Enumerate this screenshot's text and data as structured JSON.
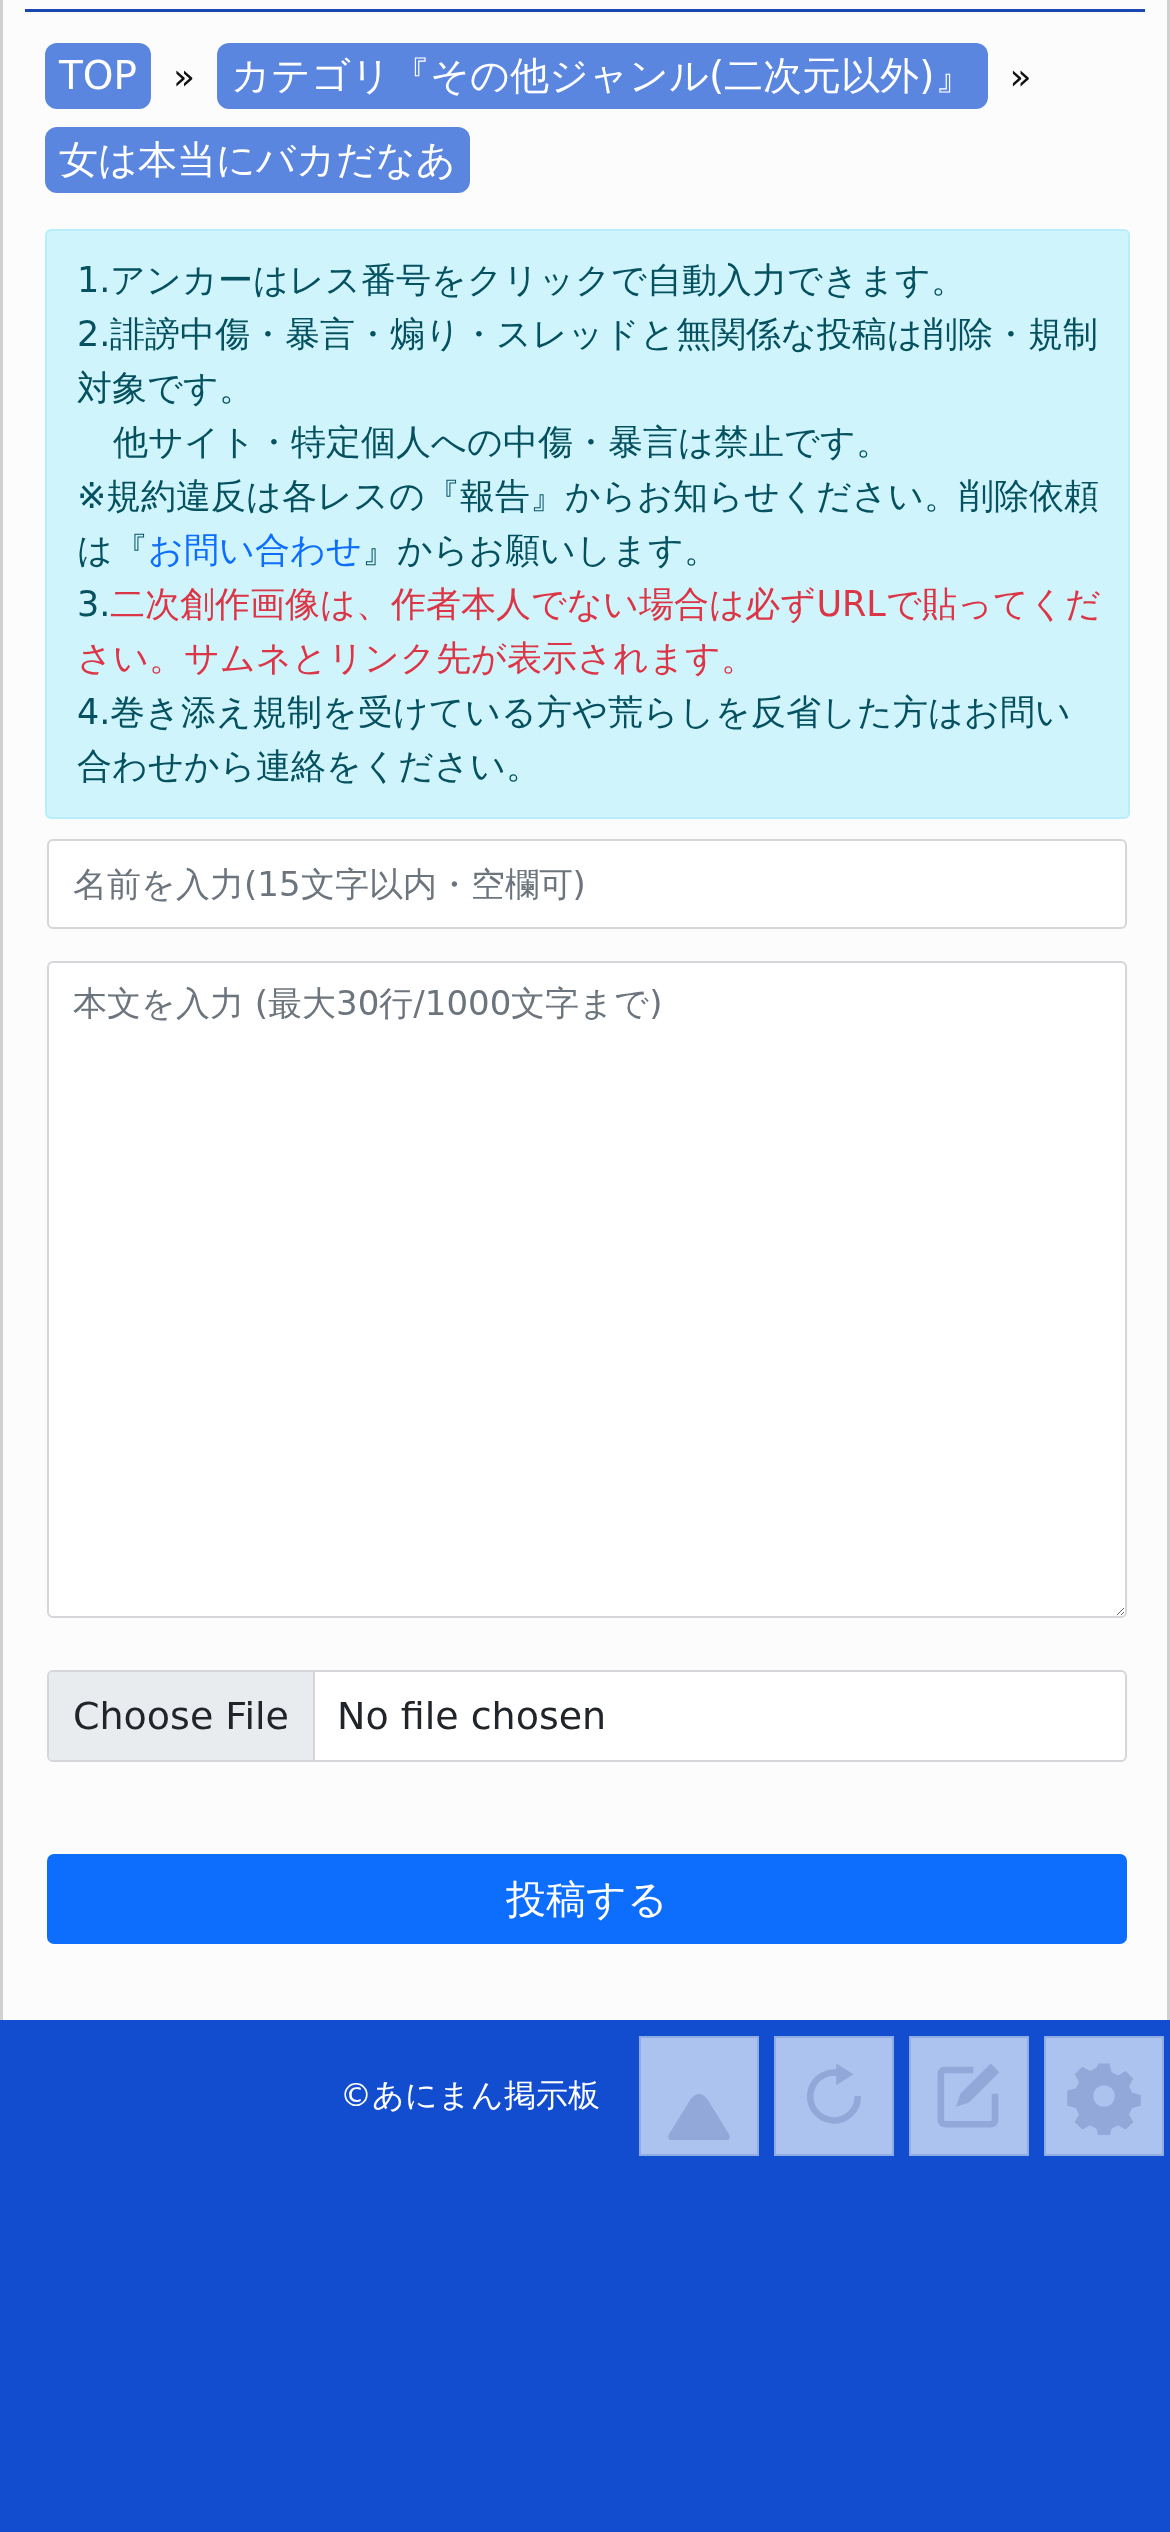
{
  "breadcrumbs": [
    {
      "label": "TOP"
    },
    {
      "label": "カテゴリ『その他ジャンル(二次元以外)』"
    },
    {
      "label": "女は本当にバカだなあ"
    }
  ],
  "breadcrumb_separator": "»",
  "notices": [
    {
      "indented": false,
      "parts": [
        {
          "kind": "plain",
          "text": "1.アンカーはレス番号をクリックで自動入力できます。"
        }
      ]
    },
    {
      "indented": false,
      "parts": [
        {
          "kind": "plain",
          "text": "2.誹謗中傷・暴言・煽り・スレッドと無関係な投稿は削除・規制対象です。"
        }
      ]
    },
    {
      "indented": true,
      "parts": [
        {
          "kind": "plain",
          "text": "他サイト・特定個人への中傷・暴言は禁止です。"
        }
      ]
    },
    {
      "indented": false,
      "parts": [
        {
          "kind": "plain",
          "text": "※規約違反は各レスの『報告』からお知らせください。削除依頼は『"
        },
        {
          "kind": "link",
          "text": "お問い合わせ"
        },
        {
          "kind": "plain",
          "text": "』からお願いします。"
        }
      ]
    },
    {
      "indented": false,
      "parts": [
        {
          "kind": "plain",
          "text": "3."
        },
        {
          "kind": "warning",
          "text": "二次創作画像は、作者本人でない場合は必ずURLで貼ってください。サムネとリンク先が表示されます。"
        }
      ]
    },
    {
      "indented": false,
      "parts": [
        {
          "kind": "plain",
          "text": "4.巻き添え規制を受けている方や荒らしを反省した方はお問い合わせから連絡をください。"
        }
      ]
    }
  ],
  "name_field": {
    "placeholder": "名前を入力(15文字以内・空欄可)"
  },
  "body_field": {
    "placeholder": "本文を入力 (最大30行/1000文字まで)"
  },
  "file_field": {
    "button": "Choose File",
    "status": "No file chosen"
  },
  "submit_button": "投稿する",
  "footer": {
    "copyright": "©あにまん掲示板"
  },
  "floating_buttons": [
    {
      "kind": "up"
    },
    {
      "kind": "refresh"
    },
    {
      "kind": "edit"
    },
    {
      "kind": "settings"
    }
  ]
}
